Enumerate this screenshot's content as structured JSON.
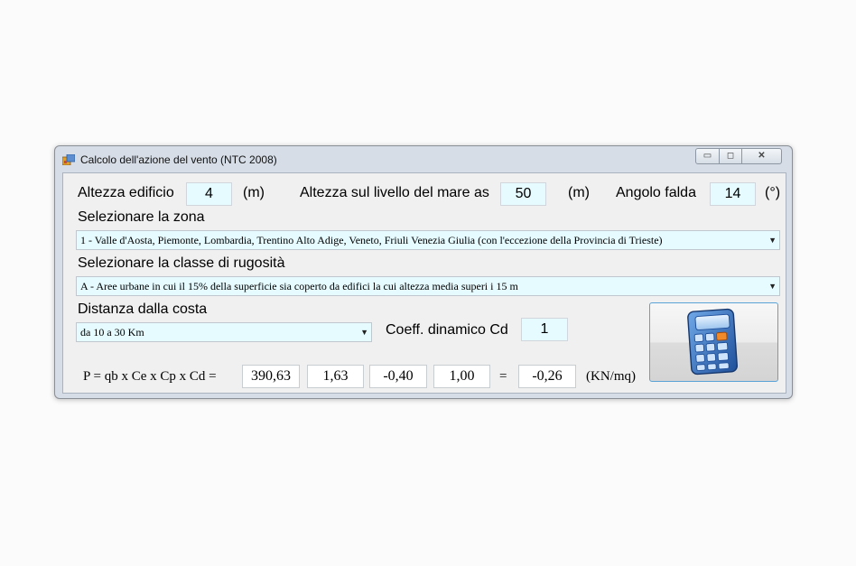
{
  "window": {
    "title": "Calcolo dell'azione del vento (NTC 2008)",
    "controls": {
      "minimize": "▭",
      "maximize": "◻",
      "close": "✕"
    }
  },
  "row1": {
    "altezza_label": "Altezza edificio",
    "altezza_value": "4",
    "altezza_unit": "(m)",
    "mare_label": "Altezza sul livello del mare as",
    "mare_value": "50",
    "mare_unit": "(m)",
    "falda_label": "Angolo falda",
    "falda_value": "14",
    "falda_unit": "(°)"
  },
  "zona": {
    "label": "Selezionare la zona",
    "selected": "1 - Valle d'Aosta, Piemonte, Lombardia, Trentino Alto Adige, Veneto, Friuli Venezia Giulia (con l'eccezione della Provincia di Trieste)"
  },
  "rugosita": {
    "label": "Selezionare la classe di rugosità",
    "selected": "A - Aree urbane in cui il 15% della superficie sia coperto da edifici la cui altezza media superi i 15 m"
  },
  "costa": {
    "label": "Distanza dalla costa",
    "selected": "da 10 a 30 Km"
  },
  "cd": {
    "label": "Coeff. dinamico Cd",
    "value": "1"
  },
  "formula": {
    "text": "P = qb x Ce x Cp x Cd =",
    "qb": "390,63",
    "ce": "1,63",
    "cp": "-0,40",
    "cd": "1,00",
    "equals": "=",
    "result": "-0,26",
    "unit": "(KN/mq)"
  },
  "icons": {
    "app": "app-window-icon",
    "calculator": "calculator-icon",
    "dropdown": "chevron-down-icon"
  }
}
